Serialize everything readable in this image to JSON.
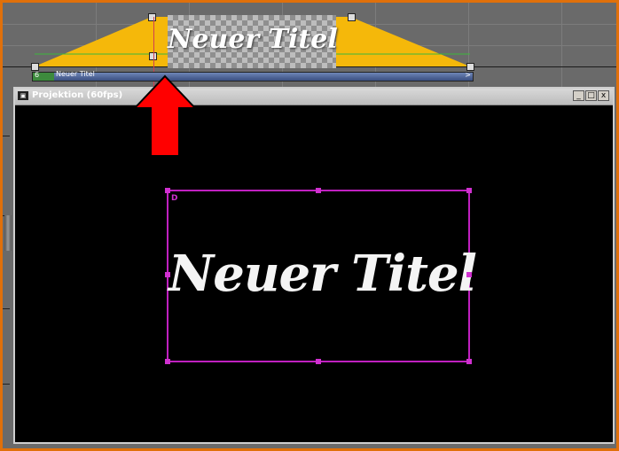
{
  "timeline": {
    "clip_title": "Neuer Titel",
    "clip_label": "Neuer Titel",
    "clip_start_marker": "6",
    "clip_end_marker": ">"
  },
  "projection_window": {
    "icon": "monitor-icon",
    "title": "Projektion (60fps)",
    "minimize_label": "_",
    "maximize_label": "□",
    "close_label": "x"
  },
  "preview": {
    "selection_label": "D",
    "title_text": "Neuer Titel"
  },
  "colors": {
    "frame_border": "#e0700a",
    "fade_shape": "#f5b80a",
    "selection": "#c020c0",
    "arrow": "#ff0000"
  }
}
